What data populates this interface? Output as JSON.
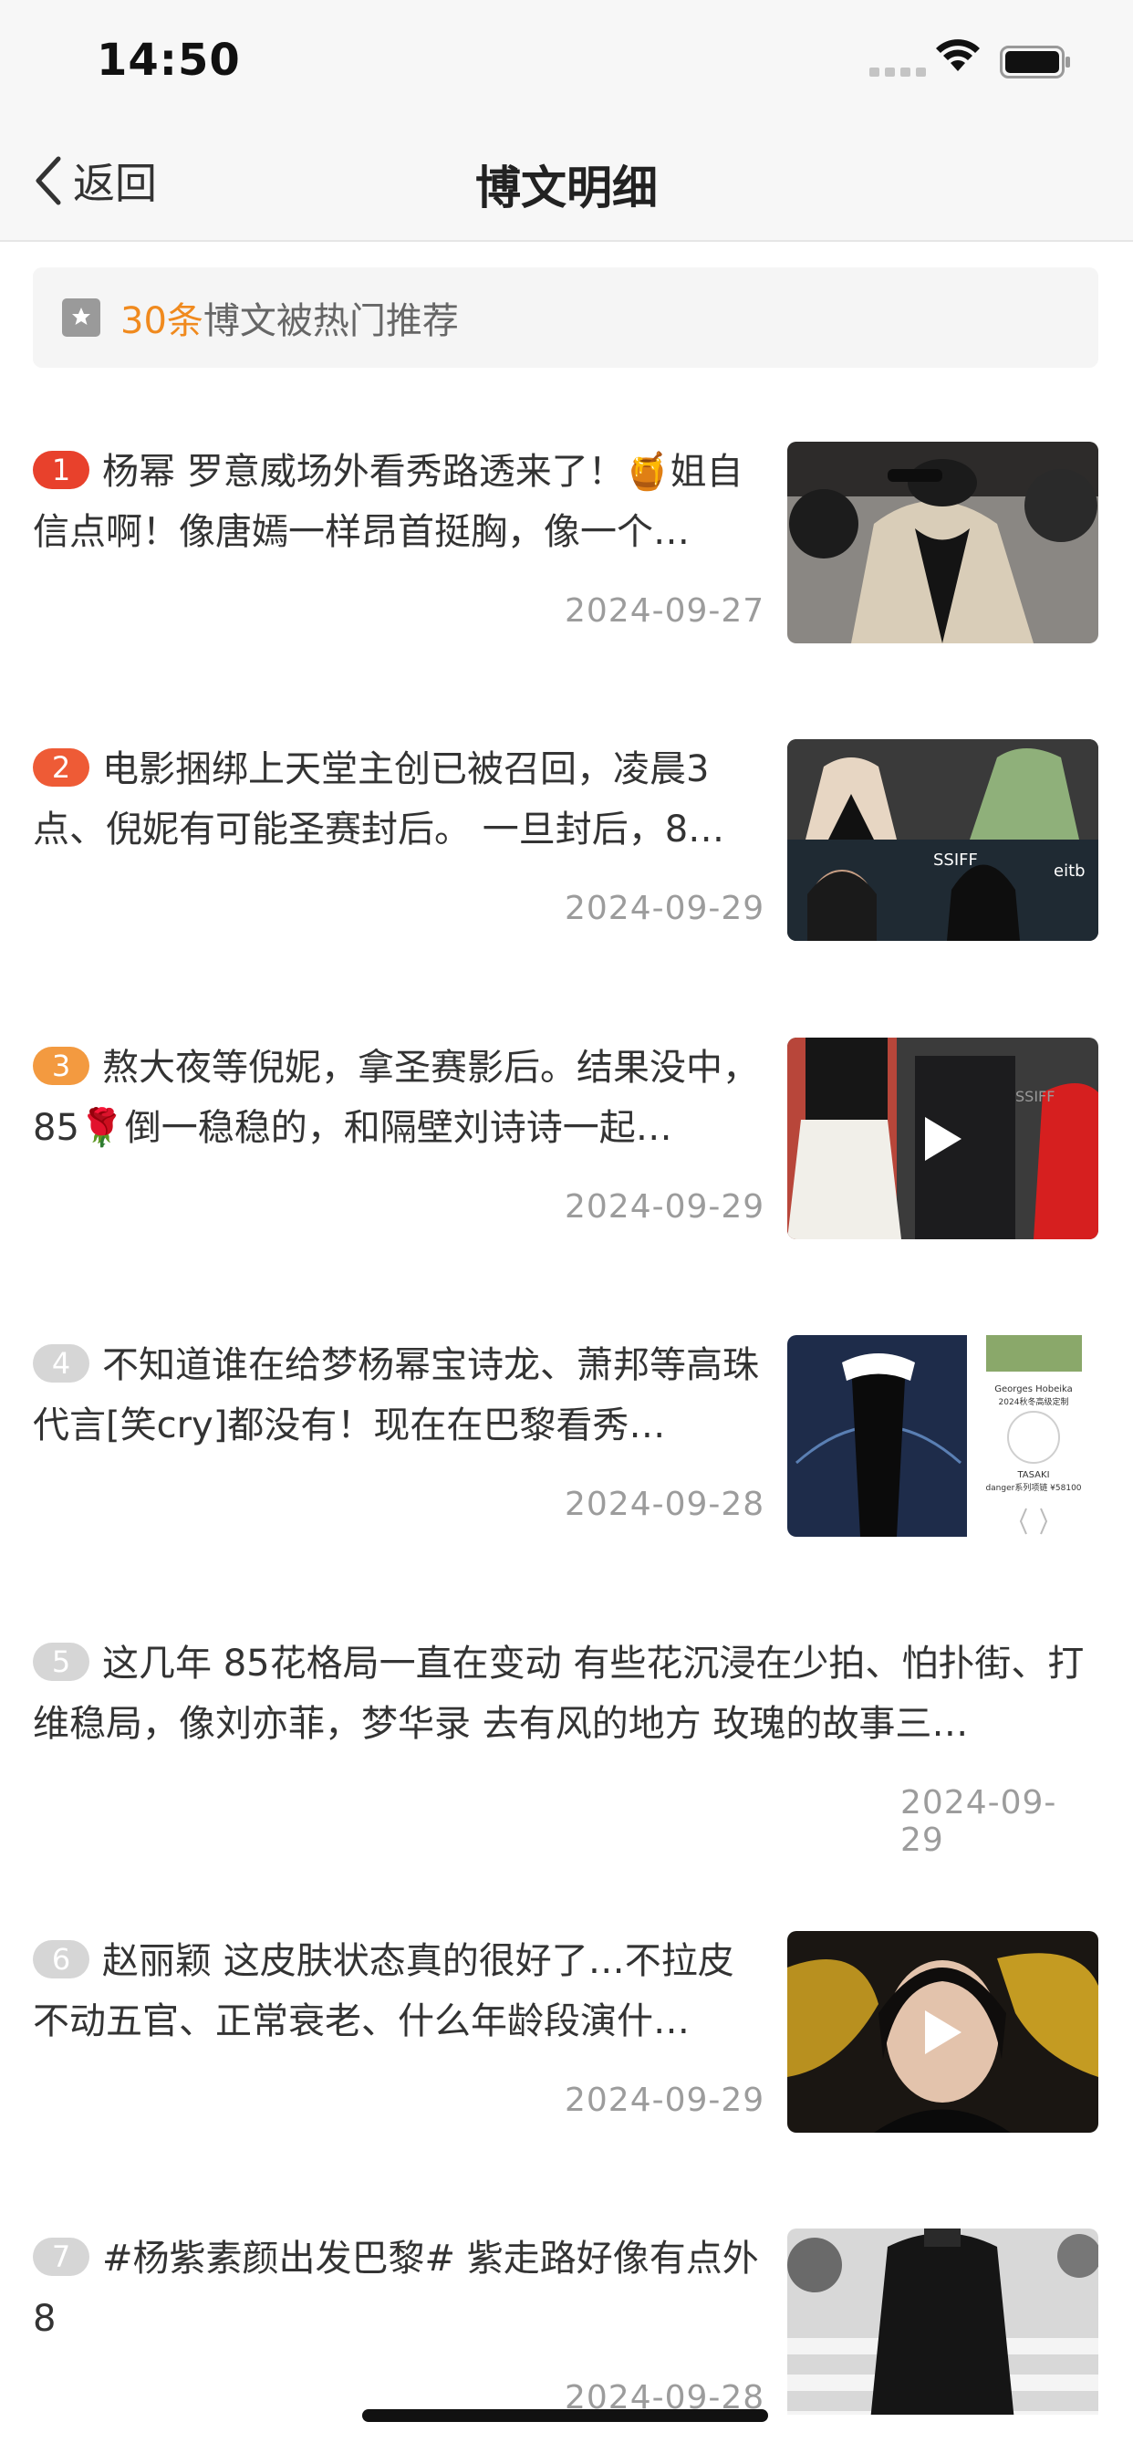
{
  "status": {
    "time": "14:50"
  },
  "nav": {
    "back_label": "返回",
    "title": "博文明细"
  },
  "banner": {
    "count": "30条",
    "text": "博文被热门推荐"
  },
  "posts": [
    {
      "rank": "1",
      "text": "杨幂 罗意威场外看秀路透来了！🍯姐自信点啊！像唐嫣一样昂首挺胸，像一个…",
      "date": "2024-09-27",
      "thumb": "photo",
      "video": false
    },
    {
      "rank": "2",
      "text": "电影捆绑上天堂主创已被召回，凌晨3点、倪妮有可能圣赛封后。 一旦封后，8…",
      "date": "2024-09-29",
      "thumb": "photo",
      "video": false
    },
    {
      "rank": "3",
      "text": "熬大夜等倪妮，拿圣赛影后。结果没中，85🌹倒一稳稳的，和隔壁刘诗诗一起…",
      "date": "2024-09-29",
      "thumb": "video",
      "video": true
    },
    {
      "rank": "4",
      "text": "不知道谁在给梦杨幂宝诗龙、萧邦等高珠代言[笑cry]都没有！现在在巴黎看秀…",
      "date": "2024-09-28",
      "thumb": "photo",
      "video": false
    },
    {
      "rank": "5",
      "text": "这几年 85花格局一直在变动 有些花沉浸在少拍、怕扑街、打维稳局，像刘亦菲，梦华录 去有风的地方 玫瑰的故事三…",
      "date": "2024-09-29",
      "thumb": "none",
      "video": false
    },
    {
      "rank": "6",
      "text": "赵丽颖 这皮肤状态真的很好了…不拉皮不动五官、正常衰老、什么年龄段演什…",
      "date": "2024-09-29",
      "thumb": "video",
      "video": true
    },
    {
      "rank": "7",
      "text": "#杨紫素颜出发巴黎# 紫走路好像有点外8",
      "date": "2024-09-28",
      "thumb": "photo",
      "video": false
    }
  ],
  "thumb4_texts": {
    "line1": "Georges Hobeika",
    "line2": "2024秋冬高级定制",
    "line3": "TASAKI",
    "line4": "danger系列项链 ¥58100",
    "ssiff1": "SSIFF",
    "ssiff2": "SSIFF",
    "eitb": "eitb"
  }
}
